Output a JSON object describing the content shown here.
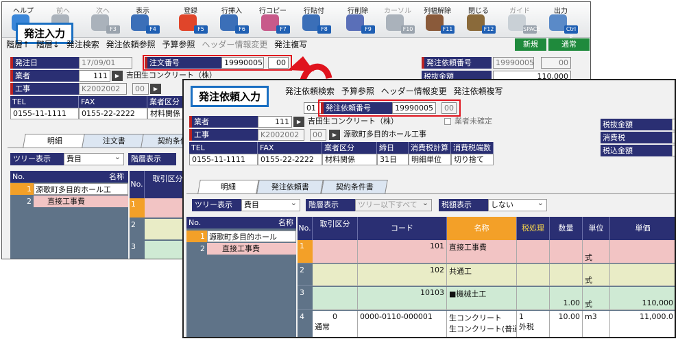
{
  "toolbar": {
    "buttons": [
      {
        "label": "ヘルプ",
        "fkey": "",
        "dis": false,
        "color": "#3a86d8"
      },
      {
        "label": "前へ",
        "fkey": "",
        "dis": true,
        "color": "#aab2bb"
      },
      {
        "label": "次へ",
        "fkey": "F3",
        "dis": true,
        "color": "#aab2bb"
      },
      {
        "label": "表示",
        "fkey": "F4",
        "dis": false,
        "color": "#3b6fb8"
      },
      {
        "label": "登録",
        "fkey": "F5",
        "dis": false,
        "color": "#e0452a"
      },
      {
        "label": "行挿入",
        "fkey": "F6",
        "dis": false,
        "color": "#3b6fb8"
      },
      {
        "label": "行コピー",
        "fkey": "F7",
        "dis": false,
        "color": "#c85a8a"
      },
      {
        "label": "行貼付",
        "fkey": "F8",
        "dis": false,
        "color": "#3b6fb8"
      },
      {
        "label": "行削除",
        "fkey": "F9",
        "dis": false,
        "color": "#5a6fb8"
      },
      {
        "label": "カーソル",
        "fkey": "F10",
        "dis": true,
        "color": "#aab2bb"
      },
      {
        "label": "列幅解除",
        "fkey": "F11",
        "dis": false,
        "color": "#8a5a3a"
      },
      {
        "label": "閉じる",
        "fkey": "F12",
        "dis": false,
        "color": "#8a6a3a"
      },
      {
        "label": "ガイド",
        "fkey": "SPACE",
        "dis": true,
        "color": "#c9d0d6"
      },
      {
        "label": "出力",
        "fkey": "Ctrl P",
        "dis": false,
        "color": "#5a8ac8"
      }
    ]
  },
  "back": {
    "title": "発注入力",
    "menu": [
      "階層↑",
      "階層↓",
      "発注検索",
      "発注依頼参照",
      "予算参照",
      "ヘッダー情報変更",
      "発注複写"
    ],
    "btn_new": "新規",
    "btn_normal": "通常",
    "labels": {
      "date": "発注日",
      "vendor": "業者",
      "project": "工事",
      "order_no": "注文番号",
      "req_no": "発注依頼番号",
      "tax_ex": "税抜金額"
    },
    "date": "17/09/01",
    "vendor_code": "111",
    "vendor_name": "吉田生コンクリート（株）",
    "project_code": "K2002002",
    "project_sub": "00",
    "order_no": "19990005",
    "order_sub": "00",
    "req_no": "19990005",
    "req_sub": "00",
    "tax_ex_val": "110,000",
    "contact_heads": [
      "TEL",
      "FAX",
      "業者区分"
    ],
    "tel": "0155-11-1111",
    "fax": "0155-22-2222",
    "category": "材料関係",
    "tabs": [
      "明細",
      "注文書",
      "契約条件"
    ],
    "tree_label": "ツリー表示",
    "tree_val": "費目",
    "level_label": "階層表示",
    "grid_head": [
      "No.",
      "名称"
    ],
    "tree_rows": [
      {
        "no": "1",
        "name": "源歌町多目的ホール工"
      },
      {
        "no": "2",
        "name": "直接工事費"
      }
    ],
    "col_no": "No.",
    "col_kbn": "取引区分",
    "grid_nums": [
      "1",
      "2",
      "3"
    ]
  },
  "front": {
    "title": "発注依頼入力",
    "menu": [
      "発注依頼検索",
      "予算参照",
      "ヘッダー情報変更",
      "発注依頼複写"
    ],
    "labels": {
      "vendor": "業者",
      "project": "工事",
      "req_no": "発注依頼番号"
    },
    "date": "01",
    "vendor_code": "111",
    "vendor_name": "吉田生コンクリート（株）",
    "unconfirmed": "業者未確定",
    "project_code": "K2002002",
    "project_sub": "00",
    "project_name": "源歌町多目的ホール工事",
    "req_no": "19990005",
    "req_sub": "00",
    "side": [
      "税抜金額",
      "消費税",
      "税込金額"
    ],
    "contact_heads": [
      "TEL",
      "FAX",
      "業者区分",
      "締日",
      "消費税計算",
      "消費税端数"
    ],
    "contact_vals": [
      "0155-11-1111",
      "0155-22-2222",
      "材料関係",
      "31日",
      "明細単位",
      "切り捨て"
    ],
    "tabs": [
      "明細",
      "発注依頼書",
      "契約条件書"
    ],
    "tree_label": "ツリー表示",
    "tree_val": "費目",
    "level_label": "階層表示",
    "level_val": "ツリー以下すべて",
    "taxshow_label": "税額表示",
    "taxshow_val": "しない",
    "tree_head": [
      "No.",
      "名称"
    ],
    "tree_rows": [
      {
        "no": "1",
        "name": "源歌町多目的ホール"
      },
      {
        "no": "2",
        "name": "直接工事費"
      }
    ],
    "grid_head": [
      "No.",
      "取引区分",
      "コード",
      "名称",
      "税処理",
      "数量",
      "単位",
      "単価"
    ],
    "rows": [
      {
        "no": "1",
        "kbn": "",
        "code": "101",
        "name": "直接工事費",
        "tax": "",
        "qty": "",
        "unit": "式",
        "price": "",
        "bg": "#f2c4c4"
      },
      {
        "no": "2",
        "kbn": "",
        "code": "102",
        "name": "共通工",
        "tax": "",
        "qty": "",
        "unit": "式",
        "price": "",
        "bg": "#e9ecc6"
      },
      {
        "no": "3",
        "kbn": "",
        "code": "10103",
        "name": "■機械土工",
        "tax": "",
        "qty": "1.00",
        "unit": "式",
        "price": "110,000",
        "bg": "#cfead4"
      },
      {
        "no": "4",
        "kbn": "0",
        "kbn2": "通常",
        "code": "0000-0110-000001",
        "name": "生コンクリート",
        "name2": "生コンクリート(普通)",
        "tax": "1",
        "tax2": "外税",
        "qty": "10.00",
        "unit": "m3",
        "price": "11,000.0",
        "bg": "#ffffff"
      }
    ]
  }
}
